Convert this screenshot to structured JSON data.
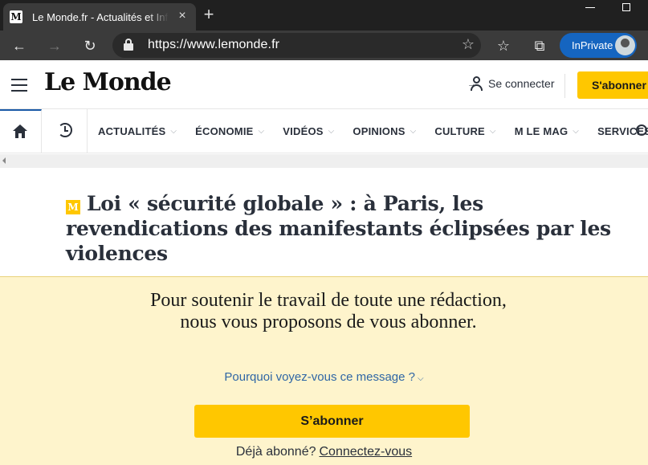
{
  "browser": {
    "tab_title": "Le Monde.fr - Actualités et Infos",
    "tab_favicon": "M",
    "url": "https://www.lemonde.fr",
    "inprivate_label": "InPrivate",
    "icons": {
      "back": "back-arrow-icon",
      "forward": "forward-arrow-icon",
      "reload": "reload-icon",
      "lock": "lock-icon",
      "favorite": "star-icon",
      "favorites": "favorites-icon",
      "collections": "collections-icon",
      "close": "close-icon",
      "new_tab": "plus-icon"
    }
  },
  "header": {
    "logo": "Le Monde",
    "login_label": "Se connecter",
    "subscribe_label": "S'abonner"
  },
  "nav": {
    "items": [
      "ACTUALITÉS",
      "ÉCONOMIE",
      "VIDÉOS",
      "OPINIONS",
      "CULTURE",
      "M LE MAG",
      "SERVICES"
    ]
  },
  "article": {
    "badge": "M",
    "headline": "Loi « sécurité globale » : à Paris, les revendications des manifestants éclipsées par les violences"
  },
  "paywall": {
    "message": "Pour soutenir le travail de toute une rédaction, nous vous proposons de vous abonner.",
    "why_link": "Pourquoi voyez-vous ce message ?",
    "subscribe_label": "S’abonner",
    "already_text": "Déjà abonné?",
    "login_link": "Connectez-vous"
  },
  "colors": {
    "accent_yellow": "#ffc700",
    "paywall_bg": "#fef4cc",
    "link_blue": "#2f66a5",
    "nav_active": "#1b5aa7",
    "inprivate_blue": "#1565c0"
  }
}
